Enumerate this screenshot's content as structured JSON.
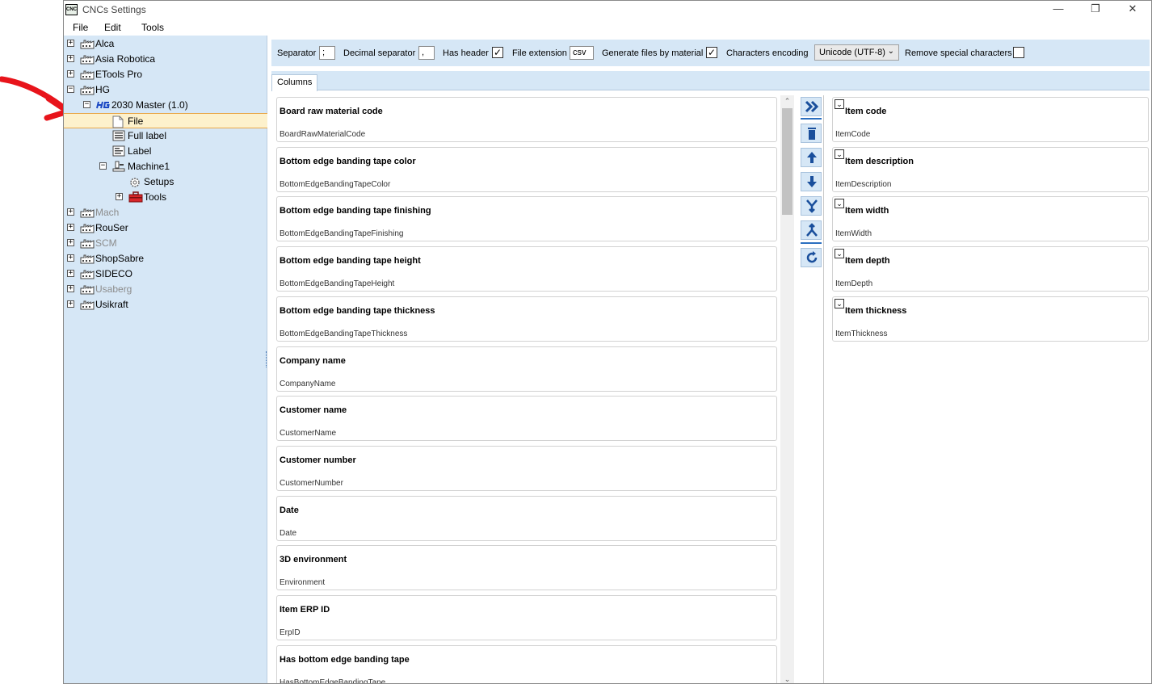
{
  "window": {
    "title": "CNCs Settings",
    "app_icon_text": "CNC"
  },
  "menu": {
    "file": "File",
    "edit": "Edit",
    "tools": "Tools"
  },
  "tree": [
    {
      "label": "Alca",
      "level": 0,
      "expander": "+",
      "icon": "factory-icon",
      "disabled": false
    },
    {
      "label": "Asia Robotica",
      "level": 0,
      "expander": "+",
      "icon": "factory-icon",
      "disabled": false
    },
    {
      "label": "ETools Pro",
      "level": 0,
      "expander": "+",
      "icon": "factory-icon",
      "disabled": false
    },
    {
      "label": "HG",
      "level": 0,
      "expander": "-",
      "icon": "factory-icon",
      "disabled": false
    },
    {
      "label": "2030 Master (1.0)",
      "level": 1,
      "expander": "-",
      "icon": "hg-logo-icon",
      "disabled": false
    },
    {
      "label": "File",
      "level": 2,
      "expander": "",
      "icon": "file-icon",
      "disabled": false,
      "selected": true
    },
    {
      "label": "Full label",
      "level": 2,
      "expander": "",
      "icon": "full-label-icon",
      "disabled": false
    },
    {
      "label": "Label",
      "level": 2,
      "expander": "",
      "icon": "label-icon",
      "disabled": false
    },
    {
      "label": "Machine1",
      "level": 2,
      "expander": "-",
      "icon": "machine-icon",
      "disabled": false
    },
    {
      "label": "Setups",
      "level": 3,
      "expander": "",
      "icon": "gear-icon",
      "disabled": false
    },
    {
      "label": "Tools",
      "level": 3,
      "expander": "+",
      "icon": "toolbox-icon",
      "disabled": false
    },
    {
      "label": "Mach",
      "level": 0,
      "expander": "+",
      "icon": "factory-icon",
      "disabled": true
    },
    {
      "label": "RouSer",
      "level": 0,
      "expander": "+",
      "icon": "factory-icon",
      "disabled": false
    },
    {
      "label": "SCM",
      "level": 0,
      "expander": "+",
      "icon": "factory-icon",
      "disabled": true
    },
    {
      "label": "ShopSabre",
      "level": 0,
      "expander": "+",
      "icon": "factory-icon",
      "disabled": false
    },
    {
      "label": "SIDECO",
      "level": 0,
      "expander": "+",
      "icon": "factory-icon",
      "disabled": false
    },
    {
      "label": "Usaberg",
      "level": 0,
      "expander": "+",
      "icon": "factory-icon",
      "disabled": true
    },
    {
      "label": "Usikraft",
      "level": 0,
      "expander": "+",
      "icon": "factory-icon",
      "disabled": false
    }
  ],
  "options": {
    "separator_label": "Separator",
    "separator_value": ";",
    "decimal_label": "Decimal separator",
    "decimal_value": ",",
    "has_header_label": "Has header",
    "has_header_checked": true,
    "extension_label": "File extension",
    "extension_value": "csv",
    "gen_by_material_label": "Generate files by material",
    "gen_by_material_checked": true,
    "encoding_label": "Characters encoding",
    "encoding_value": "Unicode (UTF-8)",
    "remove_special_label": "Remove special characters",
    "remove_special_checked": false
  },
  "tabs": {
    "columns": "Columns"
  },
  "available_columns": [
    {
      "title": "Board raw material code",
      "key": "BoardRawMaterialCode"
    },
    {
      "title": "Bottom edge banding tape color",
      "key": "BottomEdgeBandingTapeColor"
    },
    {
      "title": "Bottom edge banding tape finishing",
      "key": "BottomEdgeBandingTapeFinishing"
    },
    {
      "title": "Bottom edge banding tape height",
      "key": "BottomEdgeBandingTapeHeight"
    },
    {
      "title": "Bottom edge banding tape thickness",
      "key": "BottomEdgeBandingTapeThickness"
    },
    {
      "title": "Company name",
      "key": "CompanyName"
    },
    {
      "title": "Customer name",
      "key": "CustomerName"
    },
    {
      "title": "Customer number",
      "key": "CustomerNumber"
    },
    {
      "title": "Date",
      "key": "Date"
    },
    {
      "title": "3D environment",
      "key": "Environment"
    },
    {
      "title": "Item ERP ID",
      "key": "ErpID"
    },
    {
      "title": "Has bottom edge banding tape",
      "key": "HasBottomEdgeBandingTape"
    }
  ],
  "selected_columns": [
    {
      "title": "Item code",
      "key": "ItemCode"
    },
    {
      "title": "Item description",
      "key": "ItemDescription"
    },
    {
      "title": "Item width",
      "key": "ItemWidth"
    },
    {
      "title": "Item depth",
      "key": "ItemDepth"
    },
    {
      "title": "Item thickness",
      "key": "ItemThickness"
    }
  ],
  "actions": [
    "add-all-icon",
    "delete-icon",
    "move-up-icon",
    "move-down-icon",
    "merge-icon",
    "split-icon",
    "refresh-icon"
  ],
  "colors": {
    "tree_bg": "#d6e7f6",
    "selection_bg": "#fdf1cc",
    "accent_blue": "#2a6fc0",
    "annotation_red": "#e8141b"
  }
}
